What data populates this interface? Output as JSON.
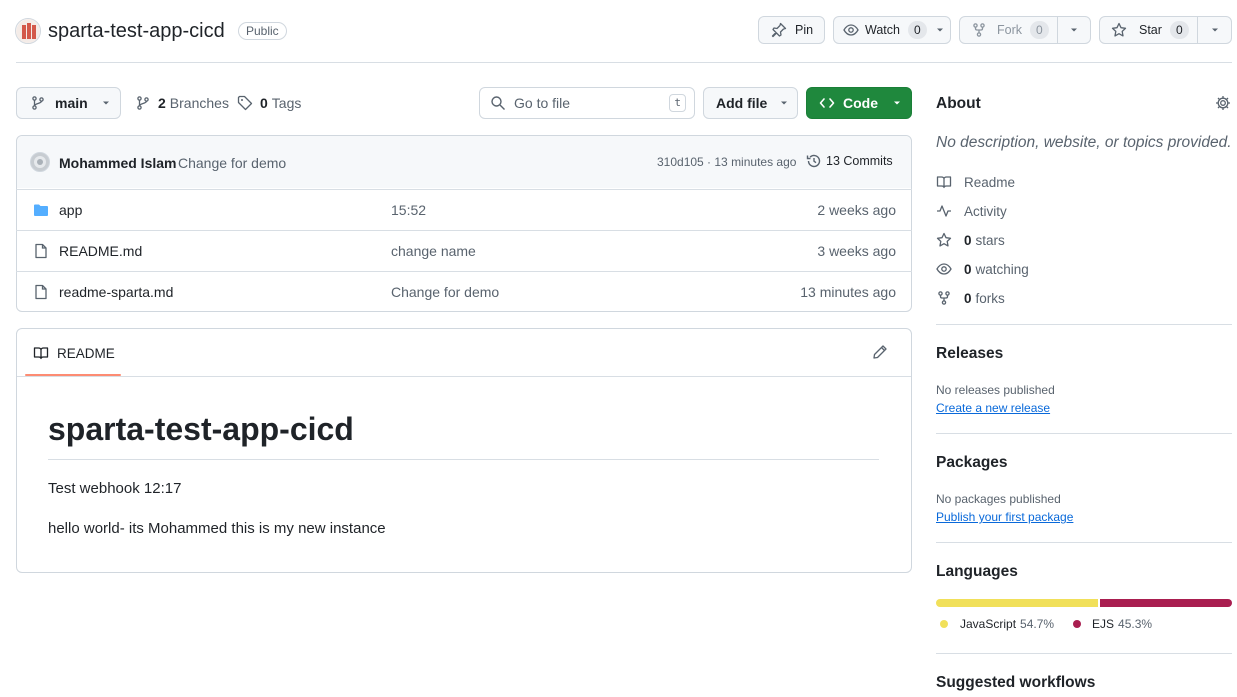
{
  "repo": {
    "name": "sparta-test-app-cicd",
    "visibility": "Public"
  },
  "header_actions": {
    "pin_label": "Pin",
    "watch_label": "Watch",
    "watch_count": "0",
    "fork_label": "Fork",
    "fork_count": "0",
    "star_label": "Star",
    "star_count": "0"
  },
  "toolbar": {
    "branch": "main",
    "branches_count": "2",
    "branches_label": "Branches",
    "tags_count": "0",
    "tags_label": "Tags",
    "search_placeholder": "Go to file",
    "search_shortcut": "t",
    "add_file_label": "Add file",
    "code_label": "Code"
  },
  "commit": {
    "author": "Mohammed Islam",
    "message": "Change for demo",
    "meta": "310d105 · 13 minutes ago",
    "commits_label": "13 Commits"
  },
  "files": [
    {
      "name": "app",
      "type": "folder",
      "message": "15:52",
      "time": "2 weeks ago"
    },
    {
      "name": "README.md",
      "type": "file",
      "message": "change name",
      "time": "3 weeks ago"
    },
    {
      "name": "readme-sparta.md",
      "type": "file",
      "message": "Change for demo",
      "time": "13 minutes ago"
    }
  ],
  "readme": {
    "tab_label": "README",
    "title": "sparta-test-app-cicd",
    "paragraphs": [
      "Test webhook 12:17",
      "hello world- its Mohammed this is my new instance"
    ]
  },
  "about": {
    "heading": "About",
    "description": "No description, website, or topics provided.",
    "readme_label": "Readme",
    "activity_label": "Activity",
    "stars_count": "0",
    "stars_label": "stars",
    "watching_count": "0",
    "watching_label": "watching",
    "forks_count": "0",
    "forks_label": "forks"
  },
  "releases": {
    "heading": "Releases",
    "empty_text": "No releases published",
    "create_link": "Create a new release"
  },
  "packages": {
    "heading": "Packages",
    "empty_text": "No packages published",
    "publish_link": "Publish your first package"
  },
  "languages": {
    "heading": "Languages",
    "items": [
      {
        "name": "JavaScript",
        "percent": "54.7%",
        "value": 54.7,
        "color": "#f1e05a"
      },
      {
        "name": "EJS",
        "percent": "45.3%",
        "value": 45.3,
        "color": "#a91e50"
      }
    ]
  },
  "workflows": {
    "heading": "Suggested workflows"
  }
}
